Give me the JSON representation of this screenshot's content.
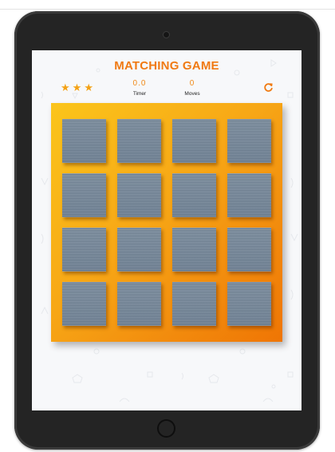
{
  "game": {
    "title": "MATCHING GAME",
    "stars": [
      "★",
      "★",
      "★"
    ],
    "timer": {
      "value": "0.0",
      "label": "Timer"
    },
    "moves": {
      "value": "0",
      "label": "Moves"
    },
    "restart_icon": "refresh-icon"
  },
  "board": {
    "rows": 4,
    "columns": 4,
    "card_state": "face-down",
    "card_count": 16
  },
  "colors": {
    "accent": "#f07a12",
    "board_gradient_start": "#fbc51b",
    "board_gradient_end": "#ef7504",
    "card_back": "#7c8ea0",
    "device_frame": "#242424",
    "screen_background": "#f7f8fa"
  }
}
